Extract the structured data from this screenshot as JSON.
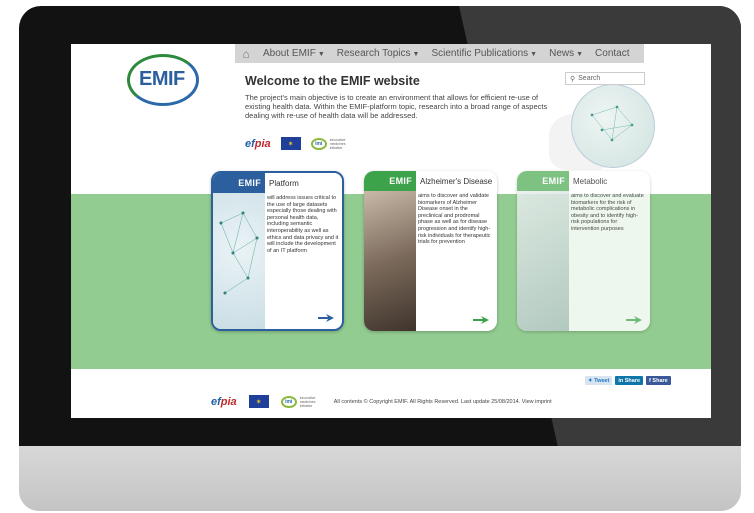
{
  "nav": {
    "items": [
      {
        "label": "About EMIF",
        "dropdown": true
      },
      {
        "label": "Research Topics",
        "dropdown": true
      },
      {
        "label": "Scientific Publications",
        "dropdown": true
      },
      {
        "label": "News",
        "dropdown": true
      },
      {
        "label": "Contact",
        "dropdown": false
      }
    ]
  },
  "logo": {
    "text": "EMIF"
  },
  "welcome": {
    "title": "Welcome to the EMIF website",
    "intro": "The project's main objective is to create an environment that allows for efficient re-use of existing health data. Within the EMIF-platform topic, research into a broad range of aspects dealing with re-use of health data will be addressed."
  },
  "search": {
    "placeholder": "Search"
  },
  "partners": {
    "efpia_a": "ef",
    "efpia_b": "pia",
    "imi": "imi",
    "imi_sub": "innovative medicines initiative"
  },
  "cards": [
    {
      "brand": "EMIF",
      "title": "Platform",
      "text": "will address issues critical to the use of large datasets especially those dealing with personal health data, including semantic interoperability as well as ethics and data privacy and it will include the development of an IT platform"
    },
    {
      "brand": "EMIF",
      "title": "Alzheimer's Disease",
      "text": "aims to discover and validate biomarkers of Alzheimer Disease onset in the preclinical and prodromal phase as well as for disease progression and identify high-risk individuals for therapeutic trials for prevention"
    },
    {
      "brand": "EMIF",
      "title": "Metabolic",
      "text": "aims to discover and evaluate biomarkers for the risk of metabolic complications in obesity and to identify high-risk populations for intervention purposes"
    }
  ],
  "share": {
    "tweet": "Tweet",
    "linkedin": "Share",
    "facebook": "Share"
  },
  "footer": {
    "copyright": "All contents © Copyright EMIF. All Rights Reserved. Last update 25/08/2014. View imprint"
  },
  "colors": {
    "emif_blue": "#2b5f9e",
    "emif_green": "#3da34a",
    "band_green": "#92cc90"
  }
}
